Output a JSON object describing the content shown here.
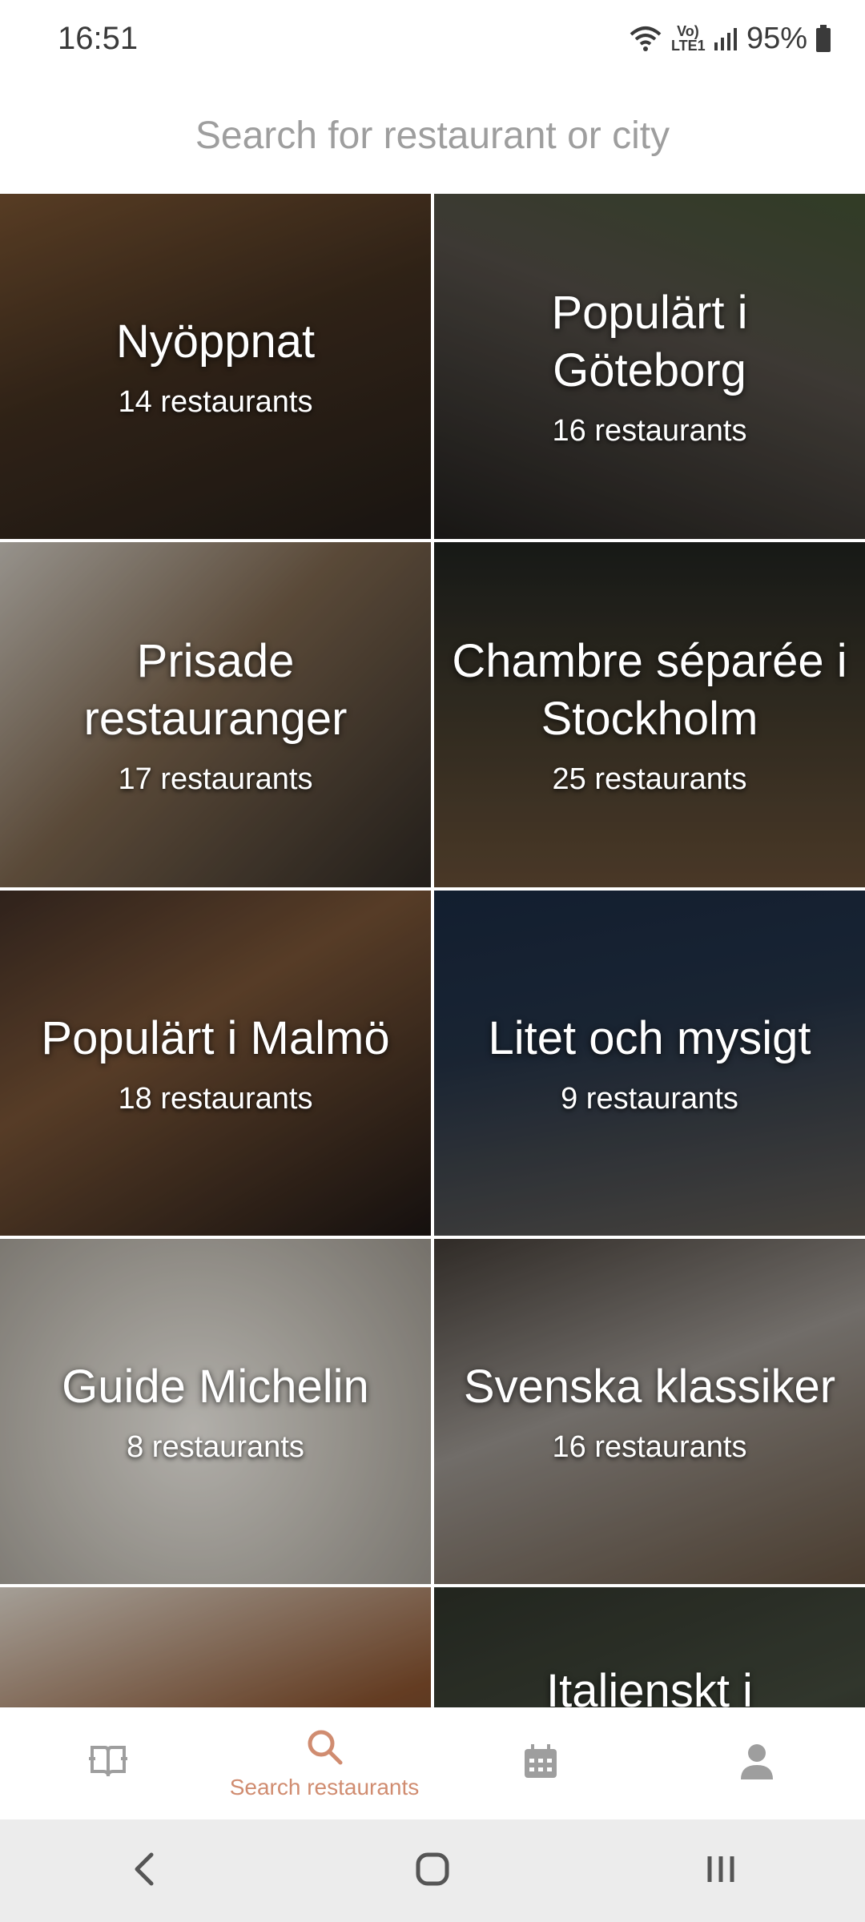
{
  "status_bar": {
    "time": "16:51",
    "network_label": "Vo) LTE1",
    "battery": "95%",
    "icons": [
      "wifi-icon",
      "volte-icon",
      "signal-icon",
      "battery-icon"
    ]
  },
  "search": {
    "placeholder": "Search for restaurant or city"
  },
  "tiles": [
    {
      "title": "Nyöppnat",
      "count": "14 restaurants"
    },
    {
      "title": "Populärt i Göteborg",
      "count": "16 restaurants"
    },
    {
      "title": "Prisade restauranger",
      "count": "17 restaurants"
    },
    {
      "title": "Chambre séparée i Stockholm",
      "count": "25 restaurants"
    },
    {
      "title": "Populärt i Malmö",
      "count": "18 restaurants"
    },
    {
      "title": "Litet och mysigt",
      "count": "9 restaurants"
    },
    {
      "title": "Guide Michelin",
      "count": "8 restaurants"
    },
    {
      "title": "Svenska klassiker",
      "count": "16 restaurants"
    },
    {
      "title": "",
      "count": ""
    },
    {
      "title": "Italienskt i",
      "count": ""
    }
  ],
  "bottom_nav": {
    "items": [
      {
        "icon": "book-icon",
        "label": ""
      },
      {
        "icon": "search-icon",
        "label": "Search restaurants",
        "active": true
      },
      {
        "icon": "calendar-icon",
        "label": ""
      },
      {
        "icon": "profile-icon",
        "label": ""
      }
    ],
    "active_color": "#d08c70",
    "inactive_color": "#9e9e9e"
  },
  "system_nav": {
    "buttons": [
      "back-icon",
      "home-icon",
      "recents-icon"
    ]
  }
}
